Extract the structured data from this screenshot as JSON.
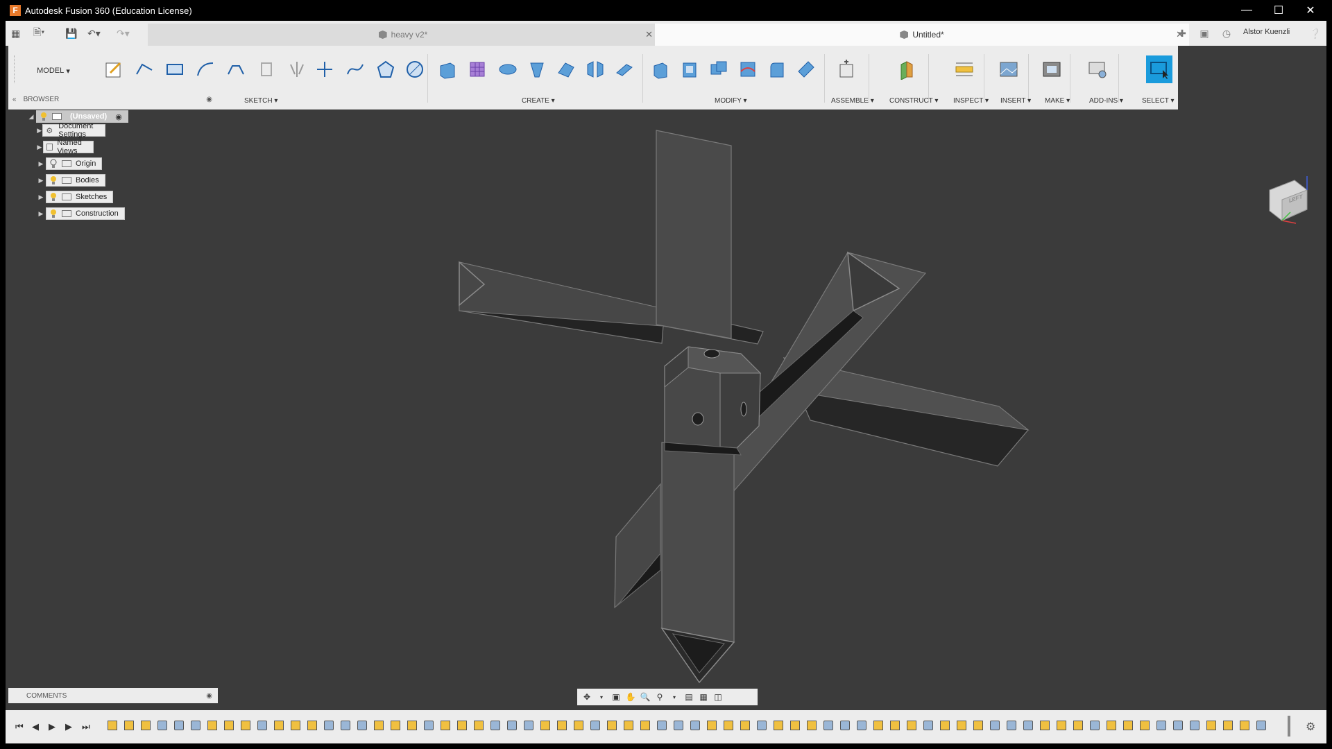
{
  "window": {
    "title": "Autodesk Fusion 360 (Education License)",
    "app_icon_letter": "F"
  },
  "tabs": [
    {
      "label": "heavy v2*",
      "active": false
    },
    {
      "label": "Untitled*",
      "active": true
    }
  ],
  "user": {
    "name": "Alstor Kuenzli"
  },
  "toolbar": {
    "workspace": "MODEL",
    "groups": [
      "SKETCH",
      "CREATE",
      "MODIFY",
      "ASSEMBLE",
      "CONSTRUCT",
      "INSPECT",
      "INSERT",
      "MAKE",
      "ADD-INS",
      "SELECT"
    ]
  },
  "browser": {
    "title": "BROWSER",
    "root": "(Unsaved)",
    "nodes": [
      "Document Settings",
      "Named Views",
      "Origin",
      "Bodies",
      "Sketches",
      "Construction"
    ]
  },
  "comments": {
    "title": "COMMENTS"
  },
  "viewcube": {
    "face": "LEFT"
  },
  "colors": {
    "accent": "#1a9bdc",
    "viewport": "#3b3b3b",
    "panel": "#ececec"
  }
}
